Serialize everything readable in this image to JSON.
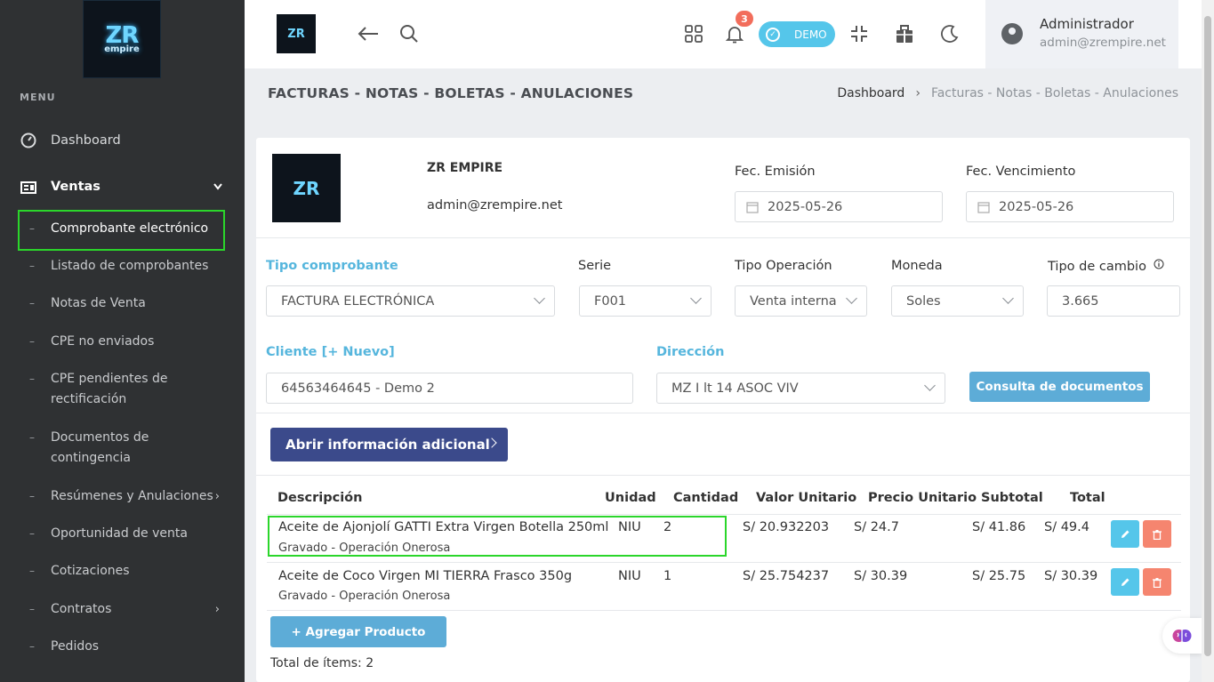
{
  "sidebar": {
    "logo": {
      "line1": "ZR",
      "line2": "empire"
    },
    "menu_title": "MENU",
    "dashboard": "Dashboard",
    "ventas": "Ventas",
    "items": [
      {
        "label": "Comprobante electrónico"
      },
      {
        "label": "Listado de comprobantes"
      },
      {
        "label": "Notas de Venta"
      },
      {
        "label": "CPE no enviados"
      },
      {
        "label": "CPE pendientes de rectificación"
      },
      {
        "label": "Documentos de contingencia"
      },
      {
        "label": "Resúmenes y Anulaciones"
      },
      {
        "label": "Oportunidad de venta"
      },
      {
        "label": "Cotizaciones"
      },
      {
        "label": "Contratos"
      },
      {
        "label": "Pedidos"
      }
    ]
  },
  "topbar": {
    "notification_count": "3",
    "demo_label": "DEMO",
    "user_name": "Administrador",
    "user_email": "admin@zrempire.net"
  },
  "page": {
    "title": "FACTURAS - NOTAS - BOLETAS - ANULACIONES",
    "breadcrumb_home": "Dashboard",
    "breadcrumb_current": "Facturas - Notas - Boletas - Anulaciones"
  },
  "company": {
    "name": "ZR EMPIRE",
    "email": "admin@zrempire.net"
  },
  "form": {
    "fec_emision_label": "Fec. Emisión",
    "fec_emision": "2025-05-26",
    "fec_venc_label": "Fec. Vencimiento",
    "fec_venc": "2025-05-26",
    "tipo_comprobante_label": "Tipo comprobante",
    "tipo_comprobante": "FACTURA ELECTRÓNICA",
    "serie_label": "Serie",
    "serie": "F001",
    "tipo_operacion_label": "Tipo Operación",
    "tipo_operacion": "Venta interna",
    "moneda_label": "Moneda",
    "moneda": "Soles",
    "tipo_cambio_label": "Tipo de cambio",
    "tipo_cambio": "3.665",
    "cliente_label": "Cliente",
    "cliente_nuevo": "[+ Nuevo]",
    "cliente": "64563464645 - Demo 2",
    "direccion_label": "Dirección",
    "direccion": "MZ I lt 14 ASOC VIV",
    "consulta_btn": "Consulta de documentos",
    "info_btn": "Abrir información adicional"
  },
  "table": {
    "headers": [
      "Descripción",
      "Unidad",
      "Cantidad",
      "Valor Unitario",
      "Precio Unitario",
      "Subtotal",
      "Total"
    ],
    "rows": [
      {
        "desc": "Aceite de Ajonjolí GATTI Extra Virgen Botella 250ml",
        "sub": "Gravado - Operación Onerosa",
        "unidad": "NIU",
        "cantidad": "2",
        "valor": "S/ 20.932203",
        "precio": "S/ 24.7",
        "subtotal": "S/ 41.86",
        "total": "S/ 49.4"
      },
      {
        "desc": "Aceite de Coco Virgen MI TIERRA Frasco 350g",
        "sub": "Gravado - Operación Onerosa",
        "unidad": "NIU",
        "cantidad": "1",
        "valor": "S/ 25.754237",
        "precio": "S/ 30.39",
        "subtotal": "S/ 25.75",
        "total": "S/ 30.39"
      }
    ],
    "add_btn": "+ Agregar Producto",
    "total_items": "Total de ítems: 2"
  }
}
